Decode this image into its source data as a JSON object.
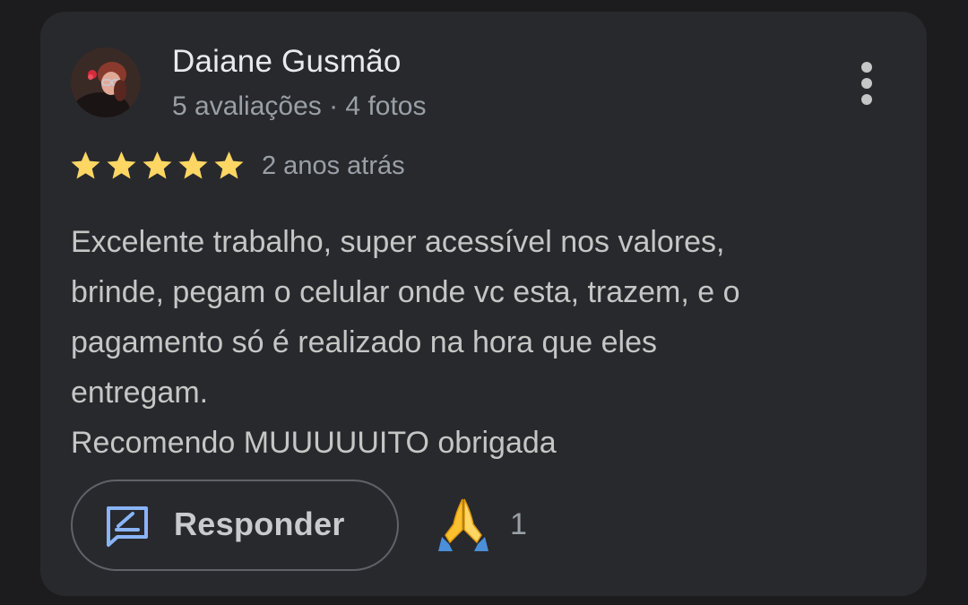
{
  "review": {
    "author": {
      "name": "Daiane Gusmão",
      "stats": "5 avaliações · 4 fotos"
    },
    "rating": {
      "stars": 5,
      "max": 5,
      "star_color": "#fdd663"
    },
    "time": "2 anos atrás",
    "text_lines": [
      "Excelente trabalho, super acessível nos valores,",
      "brinde, pegam o celular onde vc esta, trazem, e o",
      "pagamento só é realizado na hora que eles",
      "entregam.",
      "Recomendo MUUUUUITO obrigada"
    ],
    "actions": {
      "reply_label": "Responder",
      "reply_icon": "rate-review-icon",
      "menu_icon": "more-vert-icon",
      "reaction_icon": "folded-hands-emoji",
      "reaction_count": "1"
    }
  },
  "colors": {
    "card_background": "#28292d",
    "page_background": "#1c1c1e",
    "accent_blue": "#8ab4f8"
  }
}
